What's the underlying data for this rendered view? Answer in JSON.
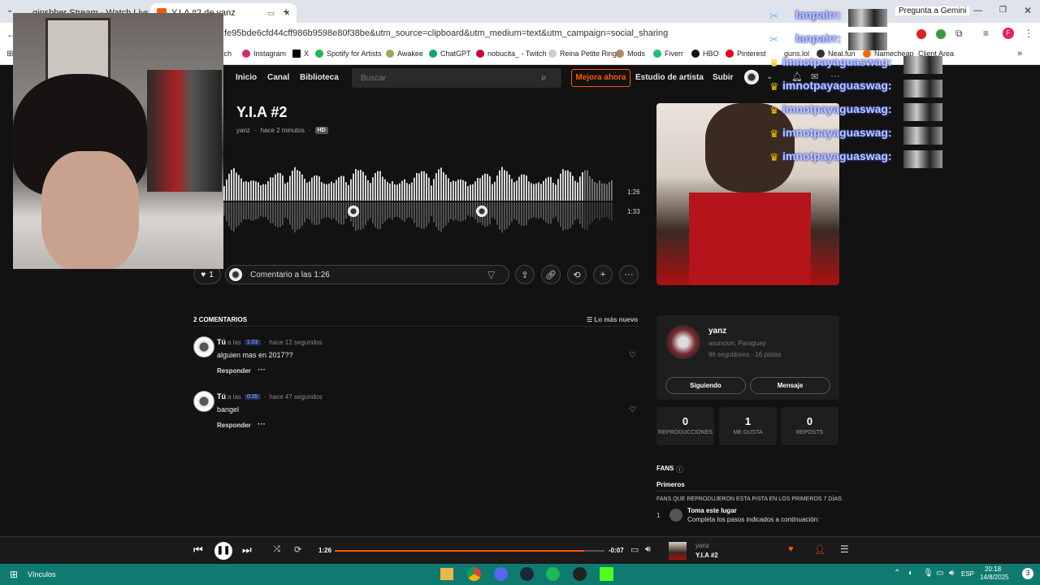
{
  "browser": {
    "tabs": [
      {
        "label": "ginshher Stream - Watch Live o"
      },
      {
        "label": "Y.I.A #2 de yanz"
      }
    ],
    "url": "fe95bde6cfd44cff986b9598e80f38be&utm_source=clipboard&utm_medium=text&utm_campaign=social_sharing",
    "gemini": "Pregunta a Gemini",
    "bookmarks": [
      "tch",
      "Instagram",
      "X",
      "Spotify for Artists",
      "Awakee",
      "ChatGPT",
      "nobucita_ - Twitch",
      "Reina Petite Ring",
      "Mods",
      "Fiverr",
      "HBO",
      "Pinterest",
      "guns.lol",
      "Neal.fun",
      "Namecheap",
      "Client Area"
    ],
    "profile_initial": "F"
  },
  "site": {
    "nav": [
      "Inicio",
      "Canal",
      "Biblioteca"
    ],
    "search_placeholder": "Buscar",
    "upgrade": "Mejora ahora",
    "studio": "Estudio de artista",
    "upload": "Subir"
  },
  "track": {
    "title": "Y.I.A #2",
    "artist": "yanz",
    "ago": "hace 2 minutos",
    "hd": "HD",
    "elapsed": "1:26",
    "duration": "1:33",
    "progress": 0.925,
    "likes": "1",
    "comment_placeholder": "Comentario a las 1:26"
  },
  "comments": {
    "header": "2 COMENTARIOS",
    "sort": "Lo más nuevo",
    "items": [
      {
        "user": "Tú",
        "at": "a las",
        "time": "1:03",
        "ago": "hace 12 segundos",
        "text": "alguien mas en 2017??",
        "reply": "Responder"
      },
      {
        "user": "Tú",
        "at": "a las",
        "time": "0:35",
        "ago": "hace 47 segundos",
        "text": "bangel",
        "reply": "Responder"
      }
    ]
  },
  "artist_card": {
    "name": "yanz",
    "location": "asuncion, Paraguay",
    "stats_line": "96 seguidores · 16 pistas",
    "follow": "Siguiendo",
    "message": "Mensaje",
    "stats": [
      {
        "n": "0",
        "l": "REPRODUCCIONES"
      },
      {
        "n": "1",
        "l": "ME GUSTA"
      },
      {
        "n": "0",
        "l": "REPOSTS"
      }
    ]
  },
  "fans": {
    "title": "FANS",
    "tab": "Primeros",
    "subtitle": "FANS QUE REPRODUJERON ESTA PISTA EN LOS PRIMEROS 7 DÍAS:",
    "rank": "1",
    "line1": "Toma este lugar",
    "line2": "Completa los pasos indicados a continuación:"
  },
  "player": {
    "elapsed": "1:26",
    "remaining": "-0:07",
    "progress": 0.925,
    "artist": "yanz",
    "title": "Y.I.A #2"
  },
  "taskbar": {
    "links": "Vínculos",
    "lang": "ESP",
    "time": "20:18",
    "date": "14/8/2025",
    "badge": "3"
  },
  "chat": {
    "lines": [
      "lanpairr:",
      "lanpairr:",
      "imnotpayaguaswag:",
      "imnotpayaguaswag:",
      "imnotpayaguaswag:",
      "imnotpayaguaswag:",
      "imnotpayaguaswag:"
    ]
  },
  "colors": {
    "accent": "#ff5500",
    "bg": "#121212",
    "taskbar": "#0f7b70",
    "chat": "#b9c8ff"
  }
}
